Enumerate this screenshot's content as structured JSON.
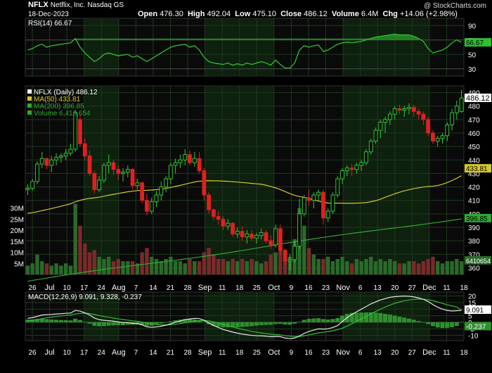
{
  "header": {
    "symbol": "NFLX",
    "company": "Netflix, Inc.",
    "exchange": "Nasdaq GS",
    "date": "18-Dec-2023",
    "open_label": "Open",
    "open": "476.30",
    "high_label": "High",
    "high": "492.04",
    "low_label": "Low",
    "low": "475.10",
    "close_label": "Close",
    "close": "486.12",
    "volume_label": "Volume",
    "volume": "6.4M",
    "chg_label": "Chg",
    "chg": "+14.06 (+2.98%)",
    "watermark": "@ StockCharts.com"
  },
  "colors": {
    "background": "#000000",
    "panel_bg": "#0a0a0a",
    "grid": "#1e3a1e",
    "band": "#0e200e",
    "up_candle": "#33cc33",
    "down_candle": "#e02020",
    "ma50": "#d6c82a",
    "ma200": "#2fa82f",
    "rsi": "#2fbf2f",
    "macd": "#e8e8e8",
    "signal": "#2fbf2f",
    "histogram": "#2f8f2f",
    "volume_up": "#2a6a2a",
    "volume_down": "#7a2a2a",
    "label_box": "#2fbf2f"
  },
  "chart_data": {
    "type": "line",
    "x_tick_labels": [
      "26",
      "Jul",
      "10",
      "17",
      "24",
      "Aug",
      "7",
      "14",
      "21",
      "28",
      "Sep",
      "11",
      "18",
      "25",
      "Oct",
      "9",
      "16",
      "23",
      "Nov",
      "6",
      "13",
      "20",
      "27",
      "Dec",
      "11",
      "18"
    ],
    "price_panel": {
      "legend": [
        "NFLX (Daily) 486.12",
        "MA(50) 433.81",
        "MA(200) 396.85",
        "Volume 6,410,654"
      ],
      "y_ticks": [
        360,
        370,
        380,
        390,
        400,
        410,
        420,
        430,
        440,
        450,
        460,
        470,
        480,
        490
      ],
      "ylim": [
        355,
        495
      ],
      "volume_ticks": [
        "5M",
        "10M",
        "15M",
        "20M",
        "25M",
        "30M"
      ],
      "volume_max": 35,
      "current_labels": {
        "close": "486.12",
        "ma50": "433.81",
        "ma200": "396.85",
        "volume": "6410654"
      },
      "ma50_end": 433.81,
      "ma200_end": 396.85,
      "ohlc": [
        [
          418,
          422,
          414,
          419
        ],
        [
          419,
          426,
          417,
          424
        ],
        [
          424,
          439,
          422,
          437
        ],
        [
          437,
          446,
          434,
          441
        ],
        [
          441,
          442,
          433,
          436
        ],
        [
          436,
          443,
          431,
          440
        ],
        [
          440,
          445,
          436,
          442
        ],
        [
          442,
          445,
          438,
          443
        ],
        [
          443,
          448,
          440,
          445
        ],
        [
          445,
          452,
          443,
          448
        ],
        [
          448,
          477,
          446,
          475
        ],
        [
          470,
          474,
          450,
          452
        ],
        [
          452,
          456,
          440,
          443
        ],
        [
          443,
          447,
          428,
          430
        ],
        [
          430,
          432,
          415,
          418
        ],
        [
          418,
          428,
          416,
          425
        ],
        [
          425,
          438,
          423,
          436
        ],
        [
          436,
          444,
          430,
          438
        ],
        [
          438,
          440,
          429,
          433
        ],
        [
          433,
          436,
          425,
          430
        ],
        [
          430,
          434,
          424,
          431
        ],
        [
          431,
          436,
          427,
          433
        ],
        [
          433,
          434,
          418,
          421
        ],
        [
          421,
          426,
          418,
          423
        ],
        [
          423,
          424,
          408,
          410
        ],
        [
          410,
          415,
          399,
          402
        ],
        [
          402,
          412,
          400,
          409
        ],
        [
          409,
          417,
          405,
          414
        ],
        [
          414,
          424,
          410,
          420
        ],
        [
          420,
          428,
          416,
          426
        ],
        [
          426,
          438,
          422,
          436
        ],
        [
          436,
          441,
          430,
          438
        ],
        [
          438,
          444,
          434,
          440
        ],
        [
          440,
          448,
          436,
          444
        ],
        [
          444,
          447,
          436,
          438
        ],
        [
          438,
          446,
          435,
          441
        ],
        [
          441,
          446,
          430,
          432
        ],
        [
          432,
          434,
          410,
          414
        ],
        [
          414,
          416,
          400,
          403
        ],
        [
          403,
          404,
          395,
          398
        ],
        [
          398,
          402,
          392,
          396
        ],
        [
          396,
          398,
          388,
          391
        ],
        [
          391,
          396,
          388,
          393
        ],
        [
          393,
          394,
          383,
          385
        ],
        [
          385,
          390,
          382,
          387
        ],
        [
          387,
          391,
          380,
          383
        ],
        [
          383,
          388,
          378,
          385
        ],
        [
          385,
          388,
          380,
          382
        ],
        [
          382,
          386,
          378,
          384
        ],
        [
          384,
          389,
          381,
          386
        ],
        [
          386,
          388,
          378,
          380
        ],
        [
          380,
          384,
          374,
          377
        ],
        [
          377,
          392,
          375,
          389
        ],
        [
          389,
          392,
          370,
          373
        ],
        [
          373,
          374,
          362,
          365
        ],
        [
          365,
          370,
          358,
          366
        ],
        [
          366,
          380,
          364,
          376
        ],
        [
          376,
          411,
          374,
          400
        ],
        [
          400,
          414,
          398,
          412
        ],
        [
          412,
          418,
          406,
          410
        ],
        [
          410,
          416,
          404,
          414
        ],
        [
          414,
          418,
          410,
          416
        ],
        [
          416,
          418,
          392,
          397
        ],
        [
          397,
          404,
          394,
          402
        ],
        [
          402,
          416,
          400,
          414
        ],
        [
          414,
          428,
          412,
          426
        ],
        [
          426,
          434,
          422,
          432
        ],
        [
          432,
          436,
          428,
          434
        ],
        [
          434,
          437,
          428,
          433
        ],
        [
          433,
          438,
          430,
          436
        ],
        [
          436,
          440,
          432,
          438
        ],
        [
          438,
          448,
          436,
          446
        ],
        [
          446,
          456,
          444,
          454
        ],
        [
          454,
          464,
          452,
          462
        ],
        [
          462,
          470,
          456,
          468
        ],
        [
          468,
          472,
          460,
          470
        ],
        [
          470,
          476,
          466,
          474
        ],
        [
          474,
          480,
          470,
          478
        ],
        [
          478,
          481,
          474,
          477
        ],
        [
          477,
          480,
          472,
          478
        ],
        [
          478,
          482,
          474,
          479
        ],
        [
          479,
          481,
          472,
          476
        ],
        [
          476,
          478,
          470,
          474
        ],
        [
          474,
          476,
          466,
          470
        ],
        [
          470,
          472,
          458,
          460
        ],
        [
          460,
          462,
          452,
          454
        ],
        [
          454,
          458,
          450,
          456
        ],
        [
          456,
          460,
          452,
          458
        ],
        [
          458,
          468,
          454,
          466
        ],
        [
          466,
          478,
          462,
          475
        ],
        [
          475,
          484,
          470,
          480
        ],
        [
          476,
          492,
          475,
          486
        ]
      ],
      "volume": [
        4,
        5,
        9,
        6,
        5,
        4,
        5,
        4,
        5,
        4,
        32,
        22,
        14,
        10,
        11,
        8,
        7,
        8,
        6,
        7,
        6,
        6,
        6,
        5,
        10,
        12,
        8,
        7,
        6,
        7,
        8,
        6,
        6,
        5,
        7,
        6,
        6,
        10,
        12,
        9,
        7,
        7,
        6,
        7,
        6,
        7,
        6,
        7,
        6,
        5,
        6,
        9,
        10,
        12,
        11,
        8,
        16,
        30,
        22,
        12,
        9,
        7,
        7,
        8,
        6,
        7,
        8,
        6,
        5,
        7,
        6,
        7,
        8,
        6,
        7,
        6,
        7,
        6,
        5,
        5,
        6,
        6,
        5,
        6,
        7,
        8,
        6,
        5,
        6,
        6,
        7,
        6
      ]
    },
    "rsi_panel": {
      "legend": "RSI(14) 66.67",
      "y_ticks": [
        30,
        50,
        70,
        90
      ],
      "ylim": [
        20,
        100
      ],
      "current_label": "66.67",
      "values": [
        56,
        58,
        62,
        64,
        60,
        62,
        63,
        64,
        65,
        66,
        72,
        60,
        52,
        46,
        40,
        44,
        50,
        52,
        50,
        48,
        49,
        50,
        46,
        48,
        44,
        40,
        44,
        48,
        52,
        56,
        60,
        62,
        63,
        64,
        60,
        62,
        56,
        46,
        40,
        38,
        37,
        36,
        38,
        35,
        37,
        35,
        38,
        36,
        38,
        40,
        38,
        35,
        42,
        36,
        31,
        31,
        38,
        56,
        62,
        60,
        62,
        63,
        54,
        56,
        60,
        64,
        66,
        67,
        66,
        67,
        68,
        70,
        72,
        74,
        75,
        76,
        77,
        78,
        77,
        77,
        77,
        75,
        72,
        68,
        58,
        52,
        54,
        56,
        60,
        66,
        70,
        66.67
      ]
    },
    "macd_panel": {
      "legend": "MACD(12,26,9) 9.091, 9.328, -0.237",
      "y_ticks": [
        -10,
        -5,
        0,
        5,
        10,
        15,
        20
      ],
      "ylim": [
        -14,
        23
      ],
      "current_labels": {
        "macd": "9.091",
        "signal": "9.328",
        "histogram": "-0.237"
      },
      "macd": [
        3,
        3.5,
        4.5,
        5.5,
        5.8,
        6,
        6.3,
        6.5,
        6.8,
        7,
        9,
        8.5,
        7.2,
        5.5,
        3.2,
        2,
        1.5,
        1.2,
        0.8,
        0.3,
        -0.2,
        -0.3,
        -0.8,
        -1,
        -2,
        -3.5,
        -3.8,
        -3.5,
        -3,
        -2.2,
        -1.2,
        0,
        1,
        2,
        2.5,
        3,
        2.8,
        1.5,
        -0.5,
        -2.5,
        -4,
        -5.5,
        -6.5,
        -7.5,
        -8.3,
        -9,
        -9.5,
        -10,
        -10.2,
        -10.3,
        -10.6,
        -11,
        -10.8,
        -11,
        -12,
        -12.5,
        -12,
        -10.5,
        -8.5,
        -7,
        -6,
        -5,
        -5.2,
        -5,
        -4,
        -2.5,
        0.5,
        3.5,
        6,
        8,
        10,
        12,
        14,
        15.5,
        17,
        18,
        19,
        19.5,
        19.8,
        20,
        19.8,
        19.3,
        18.5,
        17.5,
        15.8,
        13.5,
        11.5,
        10,
        9,
        8.6,
        8.8,
        9.091
      ],
      "signal": [
        1,
        1.5,
        2,
        2.8,
        3.4,
        3.9,
        4.4,
        4.8,
        5.2,
        5.6,
        6.3,
        6.8,
        6.9,
        6.6,
        5.9,
        5.1,
        4.4,
        3.8,
        3.2,
        2.6,
        2.1,
        1.6,
        1.1,
        0.7,
        0.1,
        -0.6,
        -1.2,
        -1.7,
        -2,
        -2.1,
        -1.9,
        -1.5,
        -1,
        -0.4,
        0.2,
        0.8,
        1.2,
        1.3,
        1,
        0.3,
        -0.6,
        -1.6,
        -2.6,
        -3.6,
        -4.5,
        -5.4,
        -6.2,
        -7,
        -7.6,
        -8.1,
        -8.6,
        -9.1,
        -9.4,
        -9.7,
        -10.2,
        -10.6,
        -10.9,
        -10.8,
        -10.3,
        -9.6,
        -8.9,
        -8.1,
        -7.6,
        -7.1,
        -6.5,
        -5.7,
        -4.5,
        -2.9,
        -1.1,
        0.7,
        2.6,
        4.5,
        6.4,
        8.2,
        10,
        11.6,
        13.1,
        14.4,
        15.5,
        16.4,
        17,
        17.4,
        17.6,
        17.6,
        17.2,
        16.5,
        15.5,
        14.4,
        13.3,
        12.4,
        11.6,
        9.328
      ]
    }
  }
}
